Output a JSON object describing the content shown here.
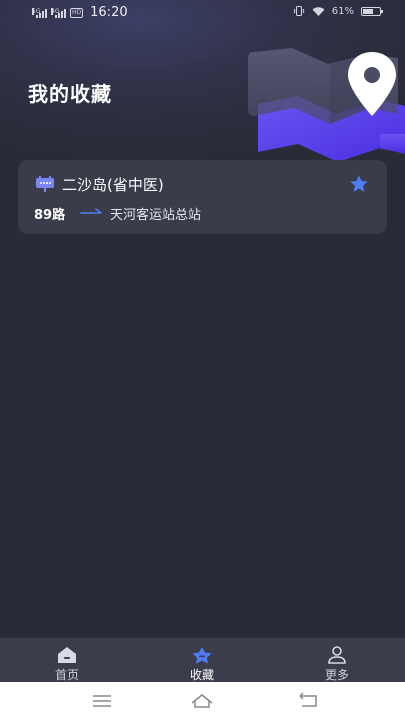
{
  "status_bar": {
    "time": "16:20",
    "battery": "61%",
    "sim1_label": "5G",
    "sim2_label": "4G",
    "hd_label": "HD",
    "battery_level": 0.61,
    "icons": [
      "signal-icon",
      "hd-icon",
      "vibrate-icon",
      "wifi-icon",
      "battery-icon"
    ]
  },
  "page": {
    "title": "我的收藏"
  },
  "favorites": [
    {
      "stop_name": "二沙岛(省中医)",
      "route": "89路",
      "destination": "天河客运站总站",
      "starred": true
    }
  ],
  "tab_bar": {
    "tabs": [
      {
        "label": "首页",
        "icon": "home-icon",
        "active": false
      },
      {
        "label": "收藏",
        "icon": "star-icon",
        "active": true
      },
      {
        "label": "更多",
        "icon": "user-icon",
        "active": false
      }
    ]
  },
  "colors": {
    "background": "#292b36",
    "card": "#3a3c4a",
    "accent": "#4f7df5",
    "purple": "#6f5af0",
    "tab_bar": "#3b3d4b"
  }
}
